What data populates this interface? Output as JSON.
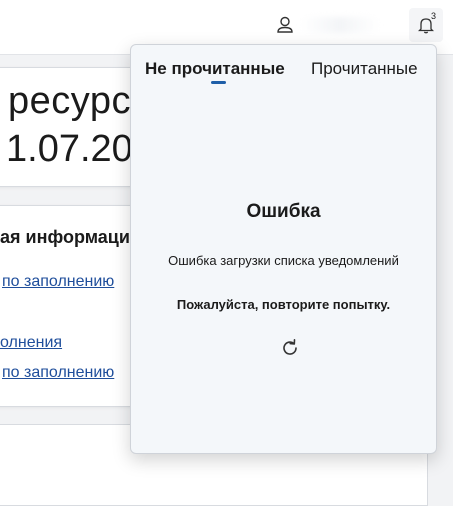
{
  "header": {
    "user_icon": "user-icon",
    "bell_icon": "bell-icon",
    "notification_count": "3"
  },
  "page": {
    "heading_fragment": "ресурса",
    "date_fragment": "1.07.20",
    "info_heading_fragment": "ая информаци",
    "links": [
      "по заполнению",
      "олнения",
      "по заполнению"
    ]
  },
  "notifications": {
    "tabs": {
      "unread": "Не прочитанные",
      "read": "Прочитанные"
    },
    "active_tab": "unread",
    "error": {
      "title": "Ошибка",
      "message": "Ошибка загрузки списка уведомлений",
      "hint": "Пожалуйста, повторите попытку."
    },
    "retry_icon": "refresh-icon"
  },
  "colors": {
    "link": "#1f4e9b",
    "accent": "#1f5fa8",
    "popover_bg": "#f4f7fa"
  }
}
